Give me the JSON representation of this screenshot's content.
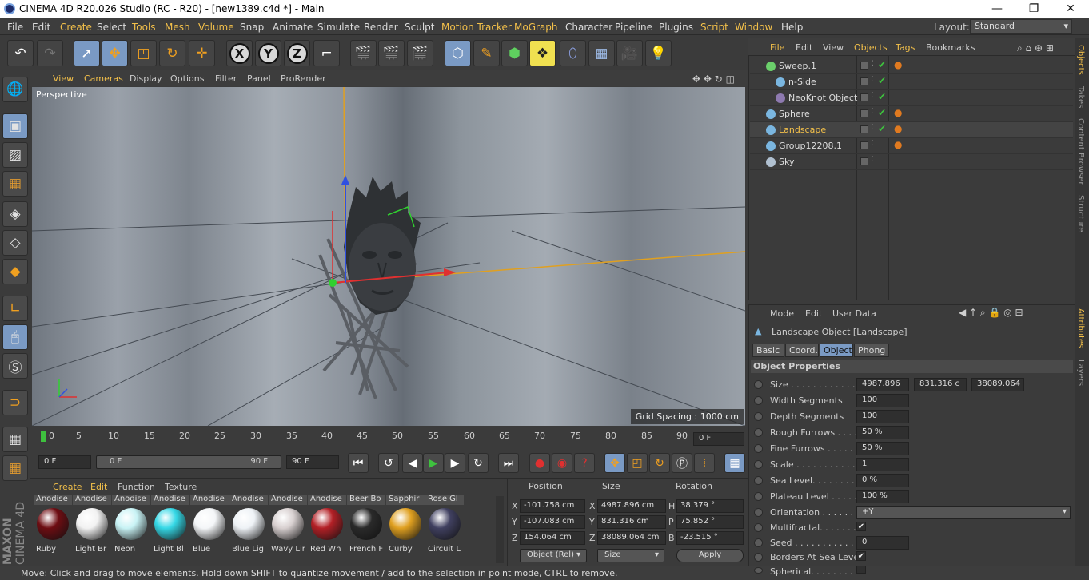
{
  "titlebar": {
    "title": "CINEMA 4D R20.026 Studio (RC - R20) - [new1389.c4d *] - Main",
    "min": "—",
    "max": "❐",
    "close": "✕"
  },
  "menu": [
    "File",
    "Edit",
    "Create",
    "Select",
    "Tools",
    "Mesh",
    "Volume",
    "Snap",
    "Animate",
    "Simulate",
    "Render",
    "Sculpt",
    "Motion Tracker",
    "MoGraph",
    "Character",
    "Pipeline",
    "Plugins",
    "Script",
    "Window",
    "Help"
  ],
  "layout": {
    "label": "Layout:",
    "value": "Standard"
  },
  "viewport": {
    "menu": [
      "View",
      "Cameras",
      "Display",
      "Options",
      "Filter",
      "Panel",
      "ProRender"
    ],
    "camera_label": "Perspective",
    "grid_spacing": "Grid Spacing : 1000 cm"
  },
  "timeline": {
    "ticks": [
      "0",
      "5",
      "10",
      "15",
      "20",
      "25",
      "30",
      "35",
      "40",
      "45",
      "50",
      "55",
      "60",
      "65",
      "70",
      "75",
      "80",
      "85",
      "90"
    ],
    "current_frame": "0 F",
    "start_field": "0 F",
    "range_start": "0 F",
    "range_end": "90 F",
    "end_field": "90 F"
  },
  "materials": {
    "menu": [
      "Create",
      "Edit",
      "Function",
      "Texture"
    ],
    "items": [
      {
        "top": "Anodise",
        "label": "Ruby",
        "color": "#6e0d12"
      },
      {
        "top": "Anodise",
        "label": "Light Br",
        "color": "#f2f2f2"
      },
      {
        "top": "Anodise",
        "label": "Neon",
        "color": "#c8f3f5"
      },
      {
        "top": "Anodise",
        "label": "Light Bl",
        "color": "#35d8e6"
      },
      {
        "top": "Anodise",
        "label": "Blue",
        "color": "#f4f6f8"
      },
      {
        "top": "Anodise",
        "label": "Blue Lig",
        "color": "#eef2f6"
      },
      {
        "top": "Anodise",
        "label": "Wavy Lir",
        "color": "#d8d0d0"
      },
      {
        "top": "Anodise",
        "label": "Red Wh",
        "color": "#b32026"
      },
      {
        "top": "Beer Bo",
        "label": "French F",
        "color": "#2a2a2a"
      },
      {
        "top": "Sapphir",
        "label": "Curby",
        "color": "#e0a020"
      },
      {
        "top": "Rose Gl",
        "label": "Circuit L",
        "color": "#404060"
      }
    ]
  },
  "coords": {
    "headers": [
      "Position",
      "Size",
      "Rotation"
    ],
    "rows": [
      {
        "axis": "X",
        "pos": "-101.758 cm",
        "saxis": "X",
        "size": "4987.896 cm",
        "raxis": "H",
        "rot": "38.379 °"
      },
      {
        "axis": "Y",
        "pos": "-107.083 cm",
        "saxis": "Y",
        "size": "831.316 cm",
        "raxis": "P",
        "rot": "75.852 °"
      },
      {
        "axis": "Z",
        "pos": "154.064 cm",
        "saxis": "Z",
        "size": "38089.064 cm",
        "raxis": "B",
        "rot": "-23.515 °"
      }
    ],
    "mode": "Object (Rel)",
    "size_mode": "Size",
    "apply": "Apply"
  },
  "status": "Move: Click and drag to move elements. Hold down SHIFT to quantize movement / add to the selection in point mode, CTRL to remove.",
  "objects": {
    "menu": [
      "File",
      "Edit",
      "View",
      "Objects",
      "Tags",
      "Bookmarks"
    ],
    "items": [
      {
        "name": "Sweep.1",
        "indent": 0,
        "icon": "#6bd06b",
        "tag": true,
        "check": true,
        "selected": false
      },
      {
        "name": "n-Side",
        "indent": 1,
        "icon": "#7ab6e0",
        "tag": false,
        "check": true,
        "selected": false
      },
      {
        "name": "NeoKnot Object",
        "indent": 1,
        "icon": "#8e7ab0",
        "tag": false,
        "check": true,
        "selected": false
      },
      {
        "name": "Sphere",
        "indent": 0,
        "icon": "#7ab6e0",
        "tag": true,
        "check": true,
        "selected": false
      },
      {
        "name": "Landscape",
        "indent": 0,
        "icon": "#7ab6e0",
        "tag": true,
        "check": true,
        "selected": true
      },
      {
        "name": "Group12208.1",
        "indent": 0,
        "icon": "#7ab6e0",
        "tag": true,
        "check": false,
        "selected": false
      },
      {
        "name": "Sky",
        "indent": 0,
        "icon": "#b0c0d0",
        "tag": false,
        "check": false,
        "selected": false
      }
    ]
  },
  "attributes": {
    "menu": [
      "Mode",
      "Edit",
      "User Data"
    ],
    "object_title": "Landscape Object [Landscape]",
    "tabs": [
      "Basic",
      "Coord.",
      "Object",
      "Phong"
    ],
    "active_tab": "Object",
    "section": "Object Properties",
    "size_label": "Size . . . . . . . . . . . . . .",
    "size_values": [
      "4987.896",
      "831.316 c",
      "38089.064"
    ],
    "fields": [
      {
        "label": "Width Segments",
        "value": "100"
      },
      {
        "label": "Depth Segments",
        "value": "100"
      },
      {
        "label": "Rough Furrows . . . .",
        "value": "50 %"
      },
      {
        "label": "Fine Furrows . . . . . .",
        "value": "50 %"
      },
      {
        "label": "Scale . . . . . . . . . . . .",
        "value": "1"
      },
      {
        "label": "Sea Level. . . . . . . . .",
        "value": "0 %"
      },
      {
        "label": "Plateau Level . . . . .",
        "value": "100 %"
      }
    ],
    "orientation_label": "Orientation . . . . . . .",
    "orientation_value": "+Y",
    "multifractal": "Multifractal. . . . . . . .",
    "seed_label": "Seed . . . . . . . . . . . .",
    "seed_value": "0",
    "borders": "Borders At Sea Level",
    "spherical": "Spherical. . . . . . . . . ."
  },
  "side_tabs": {
    "top": [
      "Objects",
      "Takes",
      "Content Browser",
      "Structure"
    ],
    "bottom": [
      "Attributes",
      "Layers"
    ]
  },
  "brand": {
    "line1": "MAXON",
    "line2": "CINEMA 4D"
  }
}
